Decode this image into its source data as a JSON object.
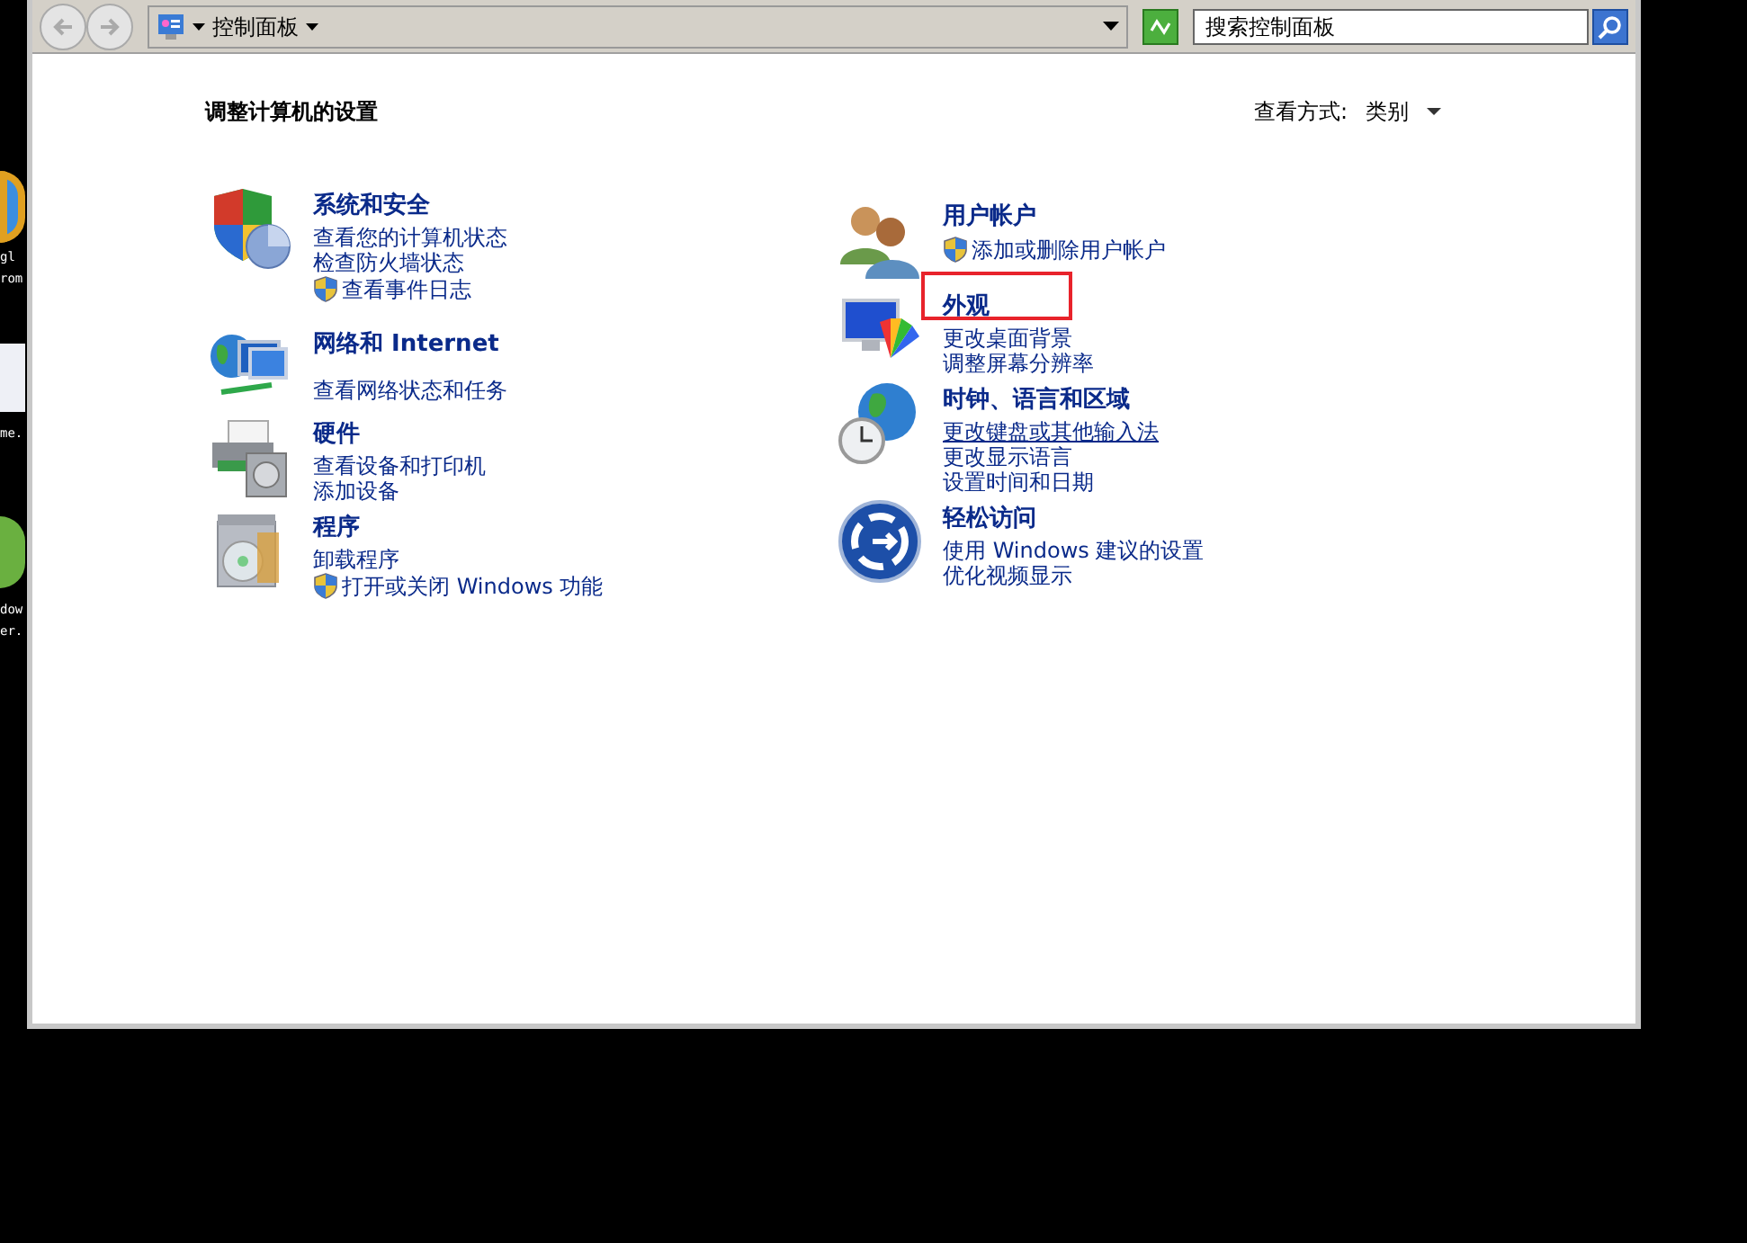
{
  "desktop": {
    "labels": [
      "gl",
      "rom",
      "me.",
      "dow",
      "er."
    ]
  },
  "toolbar": {
    "address": "控制面板",
    "search": {
      "placeholder": "搜索控制面板"
    }
  },
  "header": {
    "title": "调整计算机的设置",
    "view_by_label": "查看方式:",
    "view_by_value": "类别"
  },
  "columns": [
    {
      "categories": [
        {
          "kind": "security",
          "title": "系统和安全",
          "highlighted": false,
          "links": [
            {
              "text": "查看您的计算机状态",
              "shield": false,
              "hovered": false
            },
            {
              "text": "检查防火墙状态",
              "shield": false,
              "hovered": false
            },
            {
              "text": "查看事件日志",
              "shield": true,
              "hovered": false
            }
          ]
        },
        {
          "kind": "network",
          "title": "网络和 Internet",
          "highlighted": false,
          "links": [
            {
              "text": "查看网络状态和任务",
              "shield": false,
              "hovered": false
            }
          ]
        },
        {
          "kind": "hardware",
          "title": "硬件",
          "highlighted": false,
          "links": [
            {
              "text": "查看设备和打印机",
              "shield": false,
              "hovered": false
            },
            {
              "text": "添加设备",
              "shield": false,
              "hovered": false
            }
          ]
        },
        {
          "kind": "programs",
          "title": "程序",
          "highlighted": false,
          "links": [
            {
              "text": "卸载程序",
              "shield": false,
              "hovered": false
            },
            {
              "text": "打开或关闭 Windows 功能",
              "shield": true,
              "hovered": false
            }
          ]
        }
      ]
    },
    {
      "categories": [
        {
          "kind": "users",
          "title": "用户帐户",
          "highlighted": false,
          "links": [
            {
              "text": "添加或删除用户帐户",
              "shield": true,
              "hovered": false
            }
          ]
        },
        {
          "kind": "appearance",
          "title": "外观",
          "highlighted": true,
          "links": [
            {
              "text": "更改桌面背景",
              "shield": false,
              "hovered": false
            },
            {
              "text": "调整屏幕分辨率",
              "shield": false,
              "hovered": false
            }
          ]
        },
        {
          "kind": "clock",
          "title": "时钟、语言和区域",
          "highlighted": false,
          "links": [
            {
              "text": "更改键盘或其他输入法",
              "shield": false,
              "hovered": true
            },
            {
              "text": "更改显示语言",
              "shield": false,
              "hovered": false
            },
            {
              "text": "设置时间和日期",
              "shield": false,
              "hovered": false
            }
          ]
        },
        {
          "kind": "access",
          "title": "轻松访问",
          "highlighted": false,
          "links": [
            {
              "text": "使用 Windows 建议的设置",
              "shield": false,
              "hovered": false
            },
            {
              "text": "优化视频显示",
              "shield": false,
              "hovered": false
            }
          ]
        }
      ]
    }
  ]
}
